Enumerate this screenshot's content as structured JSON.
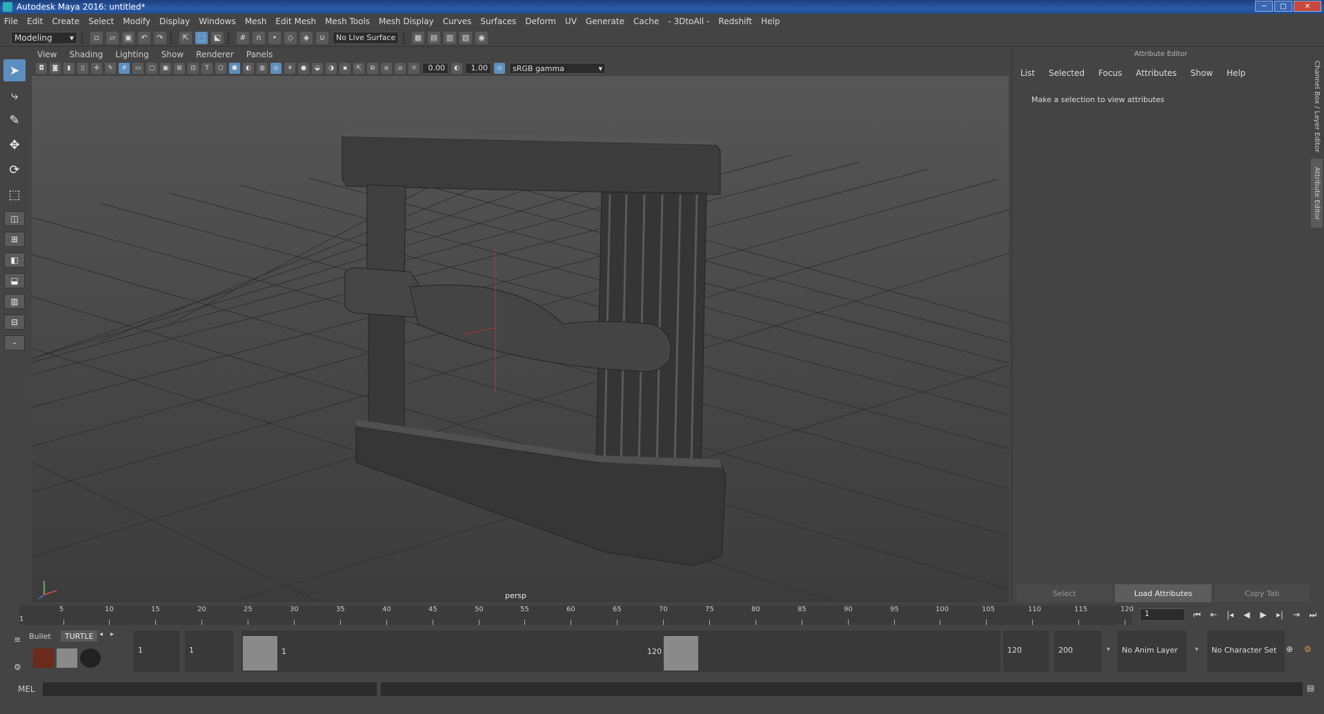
{
  "window": {
    "title": "Autodesk Maya 2016: untitled*"
  },
  "menu": [
    "File",
    "Edit",
    "Create",
    "Select",
    "Modify",
    "Display",
    "Windows",
    "Mesh",
    "Edit Mesh",
    "Mesh Tools",
    "Mesh Display",
    "Curves",
    "Surfaces",
    "Deform",
    "UV",
    "Generate",
    "Cache",
    "- 3DtoAll -",
    "Redshift",
    "Help"
  ],
  "status_line": {
    "mode": "Modeling",
    "live_surface": "No Live Surface"
  },
  "panel_menu": [
    "View",
    "Shading",
    "Lighting",
    "Show",
    "Renderer",
    "Panels"
  ],
  "panel_toolbar": {
    "exposure": "0.00",
    "gamma": "1.00",
    "color_space": "sRGB gamma"
  },
  "viewport": {
    "camera": "persp"
  },
  "attribute_editor": {
    "title": "Attribute Editor",
    "menu": [
      "List",
      "Selected",
      "Focus",
      "Attributes",
      "Show",
      "Help"
    ],
    "message": "Make a selection to view attributes",
    "buttons": [
      "Select",
      "Load Attributes",
      "Copy Tab"
    ]
  },
  "side_tabs": [
    "Channel Box / Layer Editor",
    "Attribute Editor"
  ],
  "time_slider": {
    "ticks": [
      "5",
      "10",
      "15",
      "20",
      "25",
      "30",
      "35",
      "40",
      "45",
      "50",
      "55",
      "60",
      "65",
      "70",
      "75",
      "80",
      "85",
      "90",
      "95",
      "100",
      "105",
      "110",
      "115",
      "120"
    ],
    "start_label": "1",
    "current_frame": "1"
  },
  "range_slider": {
    "shelf_tabs": [
      "Bullet",
      "TURTLE"
    ],
    "start_time": "1",
    "playback_start": "1",
    "range_start_label": "1",
    "range_end_label": "120",
    "playback_end": "120",
    "end_time": "200",
    "anim_layer": "No Anim Layer",
    "character_set": "No Character Set"
  },
  "command_line": {
    "label": "MEL"
  }
}
